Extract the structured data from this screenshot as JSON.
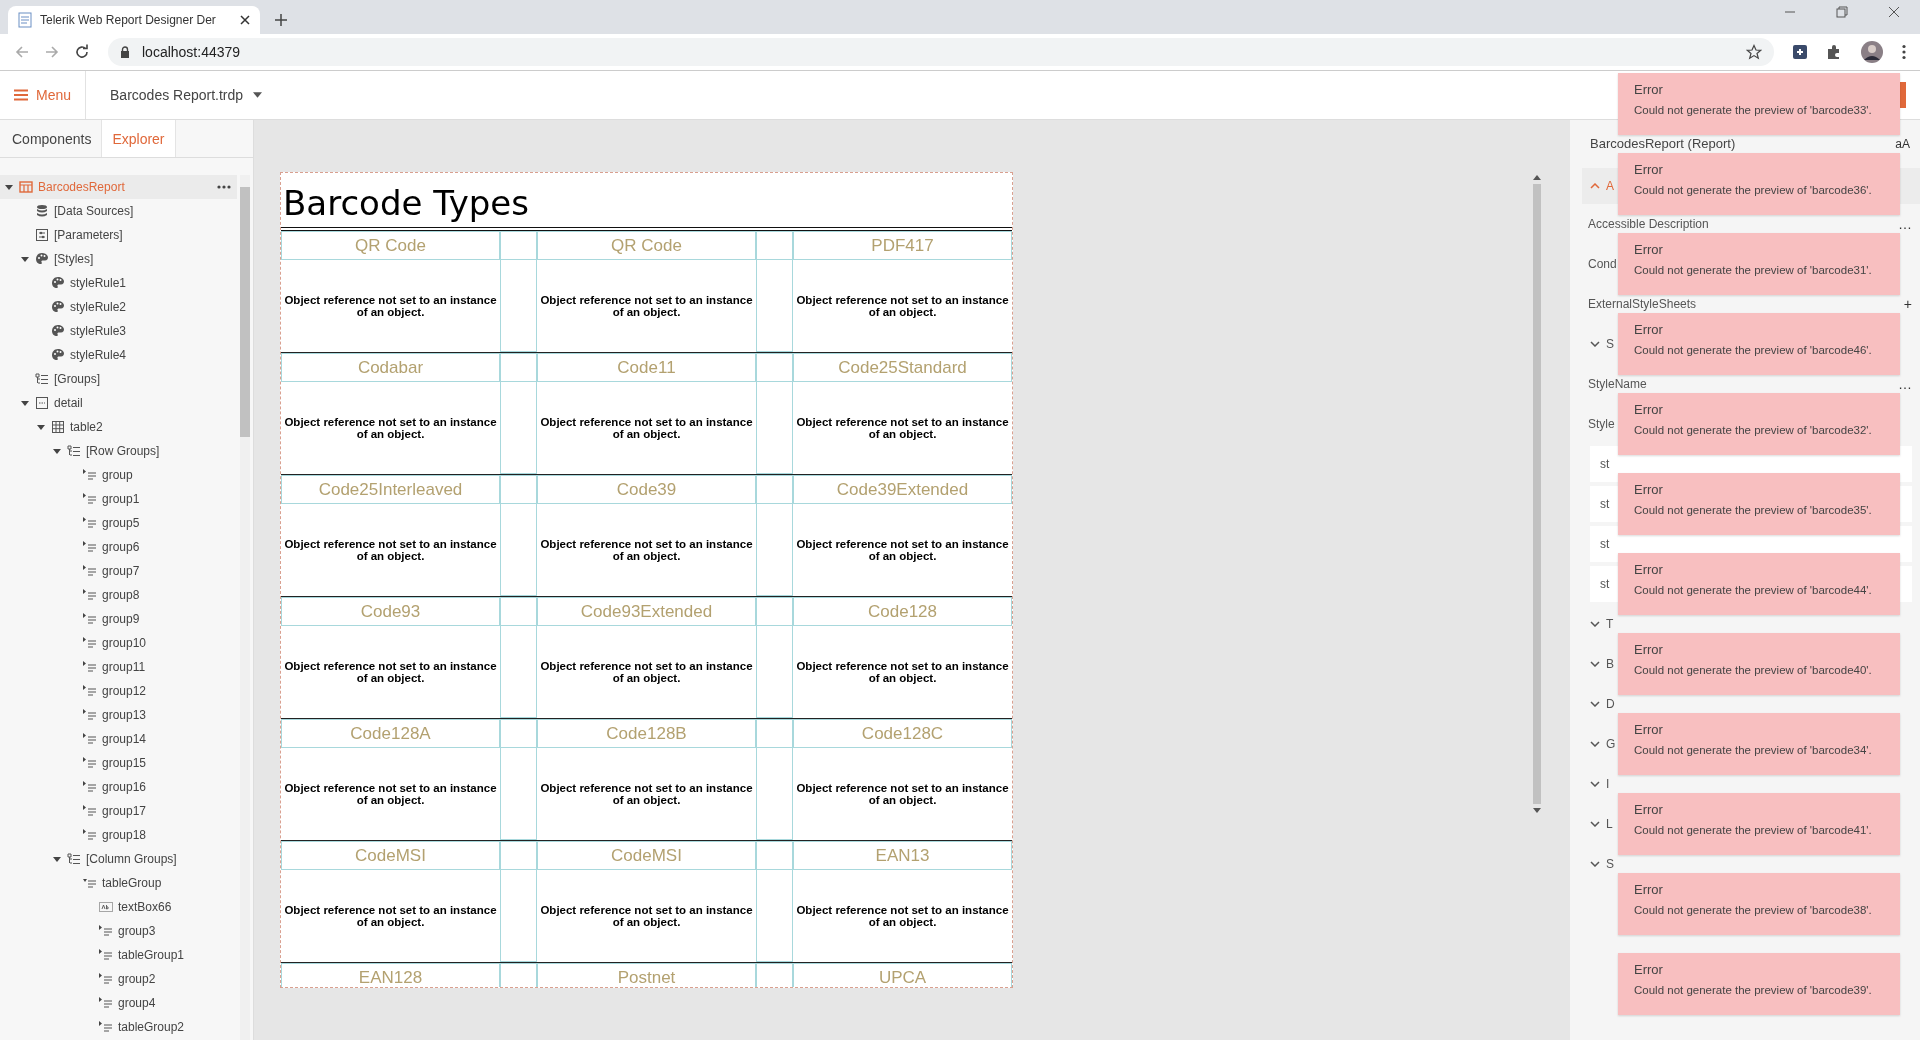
{
  "browser": {
    "tab_title": "Telerik Web Report Designer Der",
    "address": "localhost:44379"
  },
  "header": {
    "menu_label": "Menu",
    "file_name": "Barcodes Report.trdp"
  },
  "left_tabs": [
    {
      "label": "Components",
      "selected": false
    },
    {
      "label": "Explorer",
      "selected": true
    }
  ],
  "tree": [
    {
      "label": "BarcodesReport",
      "kind": "report",
      "expanded": true,
      "selected": true,
      "children": [
        {
          "label": "[Data Sources]",
          "kind": "datasource",
          "selected": false
        },
        {
          "label": "[Parameters]",
          "kind": "parameters",
          "selected": false
        },
        {
          "label": "[Styles]",
          "kind": "styles",
          "expanded": true,
          "selected": false,
          "children": [
            {
              "label": "styleRule1",
              "kind": "stylerule",
              "selected": false
            },
            {
              "label": "styleRule2",
              "kind": "stylerule",
              "selected": false
            },
            {
              "label": "styleRule3",
              "kind": "stylerule",
              "selected": false
            },
            {
              "label": "styleRule4",
              "kind": "stylerule",
              "selected": false
            }
          ]
        },
        {
          "label": "[Groups]",
          "kind": "groups",
          "selected": false
        },
        {
          "label": "detail",
          "kind": "section",
          "expanded": true,
          "selected": false,
          "children": [
            {
              "label": "table2",
              "kind": "table",
              "expanded": true,
              "selected": false,
              "children": [
                {
                  "label": "[Row Groups]",
                  "kind": "groups",
                  "expanded": true,
                  "selected": false,
                  "children": [
                    {
                      "label": "group",
                      "kind": "group",
                      "expanded": false,
                      "selected": false
                    },
                    {
                      "label": "group1",
                      "kind": "group",
                      "expanded": false,
                      "selected": false
                    },
                    {
                      "label": "group5",
                      "kind": "group",
                      "expanded": false,
                      "selected": false
                    },
                    {
                      "label": "group6",
                      "kind": "group",
                      "expanded": false,
                      "selected": false
                    },
                    {
                      "label": "group7",
                      "kind": "group",
                      "expanded": false,
                      "selected": false
                    },
                    {
                      "label": "group8",
                      "kind": "group",
                      "expanded": false,
                      "selected": false
                    },
                    {
                      "label": "group9",
                      "kind": "group",
                      "expanded": false,
                      "selected": false
                    },
                    {
                      "label": "group10",
                      "kind": "group",
                      "expanded": false,
                      "selected": false
                    },
                    {
                      "label": "group11",
                      "kind": "group",
                      "expanded": false,
                      "selected": false
                    },
                    {
                      "label": "group12",
                      "kind": "group",
                      "expanded": false,
                      "selected": false
                    },
                    {
                      "label": "group13",
                      "kind": "group",
                      "expanded": false,
                      "selected": false
                    },
                    {
                      "label": "group14",
                      "kind": "group",
                      "expanded": false,
                      "selected": false
                    },
                    {
                      "label": "group15",
                      "kind": "group",
                      "expanded": false,
                      "selected": false
                    },
                    {
                      "label": "group16",
                      "kind": "group",
                      "expanded": false,
                      "selected": false
                    },
                    {
                      "label": "group17",
                      "kind": "group",
                      "expanded": false,
                      "selected": false
                    },
                    {
                      "label": "group18",
                      "kind": "group",
                      "expanded": false,
                      "selected": false
                    }
                  ]
                },
                {
                  "label": "[Column Groups]",
                  "kind": "groups",
                  "expanded": true,
                  "selected": false,
                  "children": [
                    {
                      "label": "tableGroup",
                      "kind": "group",
                      "expanded": true,
                      "selected": false,
                      "children": [
                        {
                          "label": "textBox66",
                          "kind": "textbox",
                          "selected": false
                        },
                        {
                          "label": "group3",
                          "kind": "group",
                          "expanded": false,
                          "selected": false
                        },
                        {
                          "label": "tableGroup1",
                          "kind": "group",
                          "expanded": false,
                          "selected": false
                        },
                        {
                          "label": "group2",
                          "kind": "group",
                          "expanded": false,
                          "selected": false
                        },
                        {
                          "label": "group4",
                          "kind": "group",
                          "expanded": false,
                          "selected": false
                        },
                        {
                          "label": "tableGroup2",
                          "kind": "group",
                          "expanded": false,
                          "selected": false
                        }
                      ]
                    }
                  ]
                }
              ]
            }
          ]
        }
      ]
    }
  ],
  "report": {
    "title": "Barcode Types",
    "rows": [
      {
        "cells": [
          {
            "label": "QR Code",
            "message": "Object reference not set to an instance of an object."
          },
          {
            "label": "QR Code",
            "message": "Object reference not set to an instance of an object."
          },
          {
            "label": "PDF417",
            "message": "Object reference not set to an instance of an object."
          }
        ]
      },
      {
        "cells": [
          {
            "label": "Codabar",
            "message": "Object reference not set to an instance of an object."
          },
          {
            "label": "Code11",
            "message": "Object reference not set to an instance of an object."
          },
          {
            "label": "Code25Standard",
            "message": "Object reference not set to an instance of an object."
          }
        ]
      },
      {
        "cells": [
          {
            "label": "Code25Interleaved",
            "message": "Object reference not set to an instance of an object."
          },
          {
            "label": "Code39",
            "message": "Object reference not set to an instance of an object."
          },
          {
            "label": "Code39Extended",
            "message": "Object reference not set to an instance of an object."
          }
        ]
      },
      {
        "cells": [
          {
            "label": "Code93",
            "message": "Object reference not set to an instance of an object."
          },
          {
            "label": "Code93Extended",
            "message": "Object reference not set to an instance of an object."
          },
          {
            "label": "Code128",
            "message": "Object reference not set to an instance of an object."
          }
        ]
      },
      {
        "cells": [
          {
            "label": "Code128A",
            "message": "Object reference not set to an instance of an object."
          },
          {
            "label": "Code128B",
            "message": "Object reference not set to an instance of an object."
          },
          {
            "label": "Code128C",
            "message": "Object reference not set to an instance of an object."
          }
        ]
      },
      {
        "cells": [
          {
            "label": "CodeMSI",
            "message": "Object reference not set to an instance of an object."
          },
          {
            "label": "CodeMSI",
            "message": "Object reference not set to an instance of an object."
          },
          {
            "label": "EAN13",
            "message": "Object reference not set to an instance of an object."
          }
        ]
      },
      {
        "cells": [
          {
            "label": "EAN128"
          },
          {
            "label": "Postnet"
          },
          {
            "label": "UPCA"
          }
        ]
      }
    ]
  },
  "properties": {
    "title": "BarcodesReport (Report)",
    "text_size_label": "aA",
    "rows": [
      {
        "kind": "section",
        "label": "A",
        "expanded": true
      },
      {
        "kind": "field",
        "label": "Accessible Description",
        "action": "…"
      },
      {
        "kind": "field",
        "label": "Cond"
      },
      {
        "kind": "field",
        "label": "ExternalStyleSheets",
        "action": "+"
      },
      {
        "kind": "section",
        "label": "S",
        "expanded": false
      },
      {
        "kind": "field",
        "label": "StyleName",
        "action": "…"
      },
      {
        "kind": "field",
        "label": "Style"
      },
      {
        "kind": "item",
        "label": "st"
      },
      {
        "kind": "item",
        "label": "st"
      },
      {
        "kind": "item",
        "label": "st"
      },
      {
        "kind": "item",
        "label": "st"
      },
      {
        "kind": "section",
        "label": "T",
        "expanded": false
      },
      {
        "kind": "section",
        "label": "B",
        "expanded": false
      },
      {
        "kind": "section",
        "label": "D",
        "expanded": false
      },
      {
        "kind": "section",
        "label": "G",
        "expanded": false
      },
      {
        "kind": "section",
        "label": "I",
        "expanded": false
      },
      {
        "kind": "section",
        "label": "L",
        "expanded": false
      },
      {
        "kind": "section",
        "label": "S",
        "expanded": false
      }
    ]
  },
  "notifications": [
    {
      "title": "Error",
      "message": "Could not generate the preview of 'barcode33'."
    },
    {
      "title": "Error",
      "message": "Could not generate the preview of 'barcode36'."
    },
    {
      "title": "Error",
      "message": "Could not generate the preview of 'barcode31'."
    },
    {
      "title": "Error",
      "message": "Could not generate the preview of 'barcode46'."
    },
    {
      "title": "Error",
      "message": "Could not generate the preview of 'barcode32'."
    },
    {
      "title": "Error",
      "message": "Could not generate the preview of 'barcode35'."
    },
    {
      "title": "Error",
      "message": "Could not generate the preview of 'barcode44'."
    },
    {
      "title": "Error",
      "message": "Could not generate the preview of 'barcode40'."
    },
    {
      "title": "Error",
      "message": "Could not generate the preview of 'barcode34'."
    },
    {
      "title": "Error",
      "message": "Could not generate the preview of 'barcode41'."
    },
    {
      "title": "Error",
      "message": "Could not generate the preview of 'barcode38'."
    },
    {
      "title": "Error",
      "message": "Could not generate the preview of 'barcode39'."
    }
  ]
}
